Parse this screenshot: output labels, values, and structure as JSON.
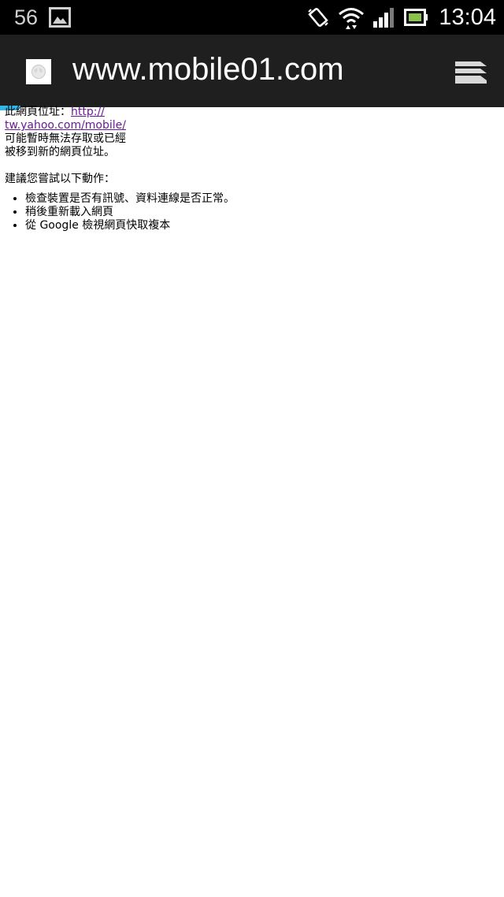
{
  "status_bar": {
    "left_number": "56",
    "time": "13:04",
    "icons": [
      "image-icon",
      "vibrate-rotate-icon",
      "wifi-icon",
      "signal-icon",
      "battery-icon"
    ]
  },
  "title_bar": {
    "url": "www.mobile01.com",
    "icons": [
      "globe-favicon-icon",
      "tabs-stack-icon"
    ]
  },
  "error_page": {
    "address_prefix": "此網頁位址：",
    "address_link_line1": "http://",
    "address_link_line2": "tw.yahoo.com/mobile/",
    "message_line1": "可能暫時無法存取或已經",
    "message_line2": "被移到新的網頁位址。",
    "suggest_heading": "建議您嘗試以下動作：",
    "suggestions": [
      "檢查裝置是否有訊號、資料連線是否正常。",
      "稍後重新載入網頁",
      "從 Google 檢視網頁快取複本"
    ]
  },
  "colors": {
    "status_bar_bg": "#000000",
    "title_bar_bg": "#1f1f1f",
    "link": "#6a1b9a",
    "accent": "#33b5e5"
  }
}
